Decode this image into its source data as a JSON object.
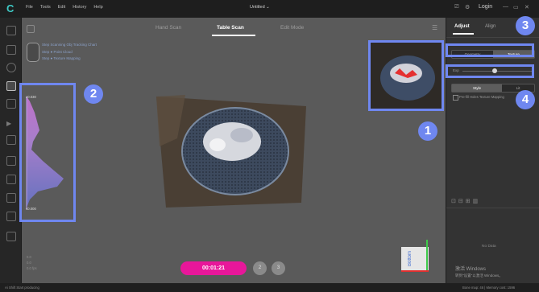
{
  "titlebar": {
    "menu": [
      "File",
      "Tools",
      "Edit",
      "History",
      "Help"
    ],
    "doc_title": "Untitled ⌄",
    "login": "Login"
  },
  "view_tabs": [
    {
      "label": "Hand Scan",
      "active": false
    },
    {
      "label": "Table Scan",
      "active": true
    },
    {
      "label": "Edit Mode",
      "active": false
    }
  ],
  "scan_info": {
    "line1": "Step   Scanning Obj    Tracking Chart",
    "line2": "Step   ●   Point Cloud",
    "line3": "Step   ●   Texture Mapping"
  },
  "depth_chart": {
    "top_label": "≥0.030",
    "bottom_label": "≤0.000"
  },
  "stats": [
    "0.0",
    "0.0",
    "0.0 fps"
  ],
  "record": {
    "time": "00:01:21",
    "step2": "2",
    "step3": "3"
  },
  "axis_label": "Bottom",
  "right_panel": {
    "tabs": [
      {
        "label": "Adjust",
        "active": true
      },
      {
        "label": "Align",
        "active": false
      }
    ],
    "mode_left": "Geometry",
    "mode_right": "Texture",
    "slider_label": "Exp",
    "style_left": "Style",
    "style_right": "Lit",
    "checkbox_label": "Pre-fill Holes  Texture Mapping",
    "no_data": "No Data"
  },
  "callouts": [
    "1",
    "2",
    "3",
    "4"
  ],
  "watermark": {
    "line1": "激活 Windows",
    "line2": "转到\"设置\"以激活 Windows。"
  },
  "statusbar": {
    "left": "Ai Shift Start producing",
    "right": "Bone map: 46 | Memory cost: 1596"
  },
  "colors": {
    "accent": "#e8179a",
    "callout": "#6f87f0",
    "brand": "#3ec9c5"
  }
}
